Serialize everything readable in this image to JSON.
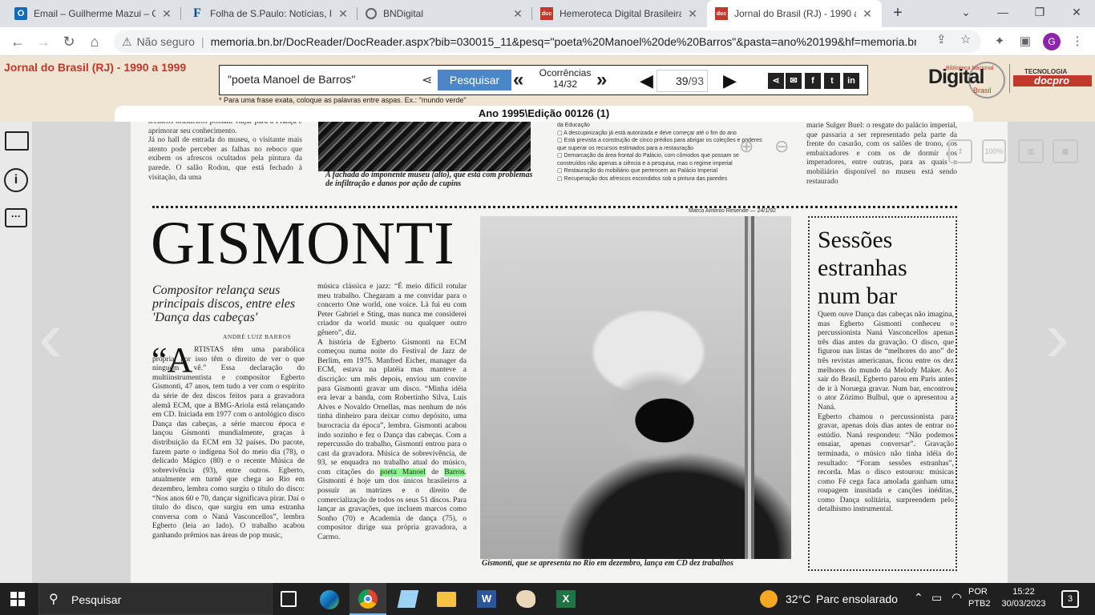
{
  "tabs": [
    {
      "title": "Email – Guilherme Mazui – O",
      "icon": "outlook-icon"
    },
    {
      "title": "Folha de S.Paulo: Notícias, Im",
      "icon": "folha-icon"
    },
    {
      "title": "BNDigital",
      "icon": "globe-icon"
    },
    {
      "title": "Hemeroteca Digital Brasileira",
      "icon": "docpro-icon"
    },
    {
      "title": "Jornal do Brasil (RJ) - 1990 a",
      "icon": "docpro-icon",
      "active": true
    }
  ],
  "address": {
    "security": "Não seguro",
    "url": "memoria.bn.br/DocReader/DocReader.aspx?bib=030015_11&pesq=\"poeta%20Manoel%20de%20Barros\"&pasta=ano%20199&hf=memoria.bn..."
  },
  "profile_initial": "G",
  "header": {
    "publication": "Jornal do Brasil (RJ) - 1990 a 1999",
    "search_value": "\"poeta Manoel de Barros\"",
    "search_button": "Pesquisar",
    "occurrences_label": "Ocorrências",
    "occurrences_value": "14/32",
    "page_value": "39",
    "page_total": "/93",
    "hint": "* Para uma frase exata, coloque as palavras entre aspas. Ex.: \"mundo verde\"",
    "edition": "Ano 1995\\Edição 00126 (1)",
    "logo_text": "Digital",
    "logo_small": "Biblioteca Nacional",
    "logo_brasil": "Brasil",
    "logo_tec": "TECNOLOGIA",
    "logo_docpro": "docpro"
  },
  "viewer": {
    "zoom_label": "100%"
  },
  "article": {
    "top_col1": "técnicos brasileiros possam viajar para a França e aprimorar seu conhecimento.\n   Já no hall de entrada do museu, o visitante mais atento pode perceber as falhas no reboco que exibem os afrescos ocultados pela pintura da parede. O salão Rodon, que está fechado à visitação, da uma",
    "top_caption": "A fachada do imponente museu (alto), que está com problemas de infiltração e danos por ação de cupins",
    "top_checklist": "da Educação\n▢ A descupinização já está autorizada e deve começar até o fim do ano\n▢ Está prevista a construção de cinco prédios para abrigar os coleções e poderes que superar os recursos estimados para a restauração\n▢ Demarcação da área frontal do Palácio, com cômodos que possam se construídos não apenas a ciência e a pesquisa, mas o regime imperial\n▢ Restauração do mobiliário que pertencem ao Palácio Imperial\n▢ Recuperação dos afrescos escondidos sob a pintura das paredes",
    "top_col4": "marie Sulger Buel: o resgate do palácio imperial, que passaria a ser representado pela parte da frente do casarão, com os salões de trono, dos embaixadores e com os de dormir dos imperadores, entre outras, para as quais o mobiliário disponível no museu está sendo restaurado",
    "headline": "GISMONTI",
    "subhead": "Compositor relança seus principais discos, entre eles 'Dança das cabeças'",
    "byline": "ANDRÉ LUIZ BARROS",
    "dropcap": "“A",
    "col1": "RTISTAS têm uma parabólica própria, por isso têm o direito de ver o que ninguém vê.” Essa declaração do multiinstrumentista e compositor Egberto Gismonti, 47 anos, tem tudo a ver com o espírito da série de dez discos feitos para a gravadora alemã ECM, que a BMG-Ariola está relançando em CD. Iniciada em 1977 com o antológico disco Dança das cabeças, a série marcou época e lançou Gismonti mundialmente, graças à distribuição da ECM em 32 países. Do pacote, fazem parte o indígena Sol do meio dia (78), o delicado Mágico (80) e o recente Música de sobrevivência (93), entre outros. Egberto, atualmente em turnê que chega ao Rio em dezembro, lembra como surgiu o título do disco: “Nos anos 60 e 70, dançar significava pirar. Daí o título do disco, que surgiu em uma estranha conversa com o Naná Vasconcellos”, lembra Egberto (leia ao lado). O trabalho acabou ganhando prêmios nas áreas de pop music,",
    "col2_before": "música clássica e jazz: “É meio difícil rotular meu trabalho. Chegaram a me convidar para o concerto One world, one voice. Lá fui eu com Peter Gabriel e Sting, mas nunca me considerei criador da world music ou qualquer outro gênero”, diz.\n   A história de Egberto Gismonti na ECM começou numa noite do Festival de Jazz de Berlim, em 1975. Manfred Eicher, manager da ECM, estava na platéia mas manteve a discrição: um mês depois, enviou um convite para Gismonti gravar um disco. “Minha idéia era levar a banda, com Robertinho Silva, Luís Alves e Novaldo Ornellas, mas nenhum de nós tinha dinheiro para deixar como depósito, uma burocracia da época”, lembra. Gismonti acabou indo sozinho e fez o Dança das cabeças. Com a repercussão do trabalho, Gismonti entrou para o cast da gravadora. Música de sobrevivência, de 93, se enquadra no trabalho atual do músico, com citações do ",
    "col2_highlight1": "poeta Manoel",
    "col2_mid": " de ",
    "col2_highlight2": "Barros",
    "col2_after": ". Gismonti é hoje um dos únicos brasileiros a possuir as matrizes e o direito de comercialização de todos os seus 51 discos. Para lançar as gravações, que incluem marcos como Sonho (70) e Academia de dança (75), o compositor dirige sua própria gravadora, a Carmo.",
    "photo_credit": "Marco Antonio Resende — 24/1/92",
    "photo_caption": "Gismonti, que se apresenta no Rio em dezembro, lança em CD dez trabalhos",
    "side_head": "Sessões estranhas num bar",
    "side_text": "Quem ouve Dança das cabeças não imagina, mas Egberto Gismonti conheceu o percussionista Naná Vasconcellos apenas três dias antes da gravação. O disco, que figurou nas listas de “melhores do ano” de três revistas americanas, ficou entre os dez melhores do mundo da Melody Maker. Ao sair do Brasil, Egberto parou em Paris antes de ir à Noruega gravar. Num bar, encontrou o ator Zózimo Bulbul, que o apresentou a Naná.\n   Egberto chamou o percussionista para gravar, apenas dois dias antes de entrar no estúdio. Naná respondeu: “Não podemos ensaiar, apenas conversar”. Gravação terminada, o músico não tinha idéia do resultado: “Foram sessões estranhas”, recorda. Mas o disco estourou: músicas como Fé cega faca amolada ganham uma roupagem inusitada e canções inéditas, como Dança solitária, surpreendem pelo detalhismo instrumental."
  },
  "taskbar": {
    "search_placeholder": "Pesquisar",
    "weather_temp": "32°C",
    "weather_desc": "Parc ensolarado",
    "lang1": "POR",
    "lang2": "PTB2",
    "time": "15:22",
    "date": "30/03/2023",
    "notif_count": "3"
  },
  "colors": {
    "accent_red": "#c0392b",
    "search_button": "#4a86c8",
    "highlight": "#8ef28e",
    "header_bg": "#f0e4d2"
  }
}
